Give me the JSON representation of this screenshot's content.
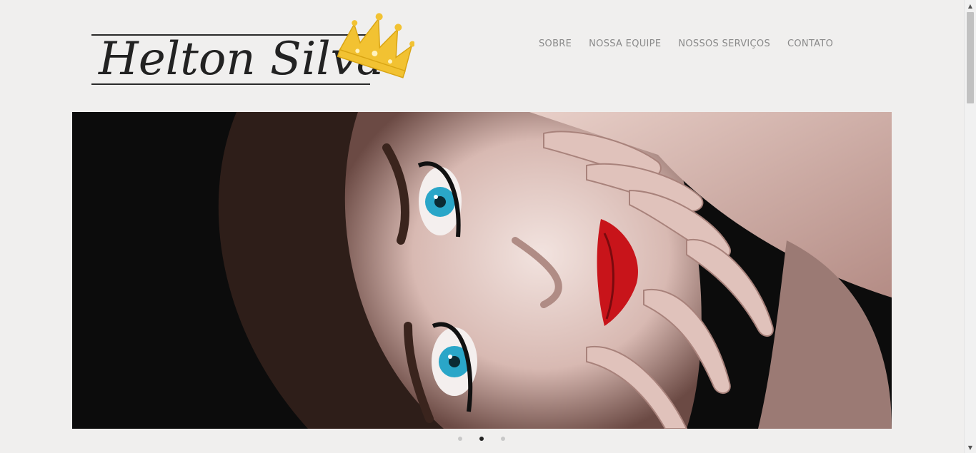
{
  "logo": {
    "text": "Helton Silva",
    "crown_color": "#f2c232",
    "icon": "crown-icon"
  },
  "nav": {
    "items": [
      {
        "label": "SOBRE"
      },
      {
        "label": "NOSSA EQUIPE"
      },
      {
        "label": "NOSSOS SERVIÇOS"
      },
      {
        "label": "CONTATO"
      }
    ]
  },
  "hero": {
    "image": "woman-blue-eyes-red-lips-photo",
    "lip_color": "#c8141a",
    "eye_color": "#2aa6c8"
  },
  "carousel": {
    "slide_count": 3,
    "active_index": 1
  }
}
